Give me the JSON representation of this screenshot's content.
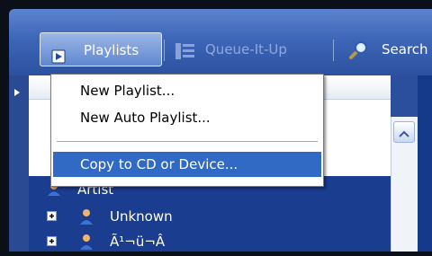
{
  "toolbar": {
    "playlists_label": "Playlists",
    "queue_label": "Queue-It-Up",
    "search_label": "Search"
  },
  "menu": {
    "items": [
      {
        "label": "New Playlist..."
      },
      {
        "label": "New Auto Playlist..."
      },
      {
        "label": "Copy to CD or Device..."
      }
    ]
  },
  "tree": {
    "header": "Artist",
    "rows": [
      {
        "label": "Unknown"
      },
      {
        "label": "Ã¹¬ü¬Â"
      }
    ]
  },
  "icons": {
    "playlists": "playlist-play-icon",
    "queue": "queue-list-icon",
    "search": "magnifier-icon",
    "expand": "plus-expander-icon",
    "artist": "person-icon"
  },
  "colors": {
    "toolbar_blue": "#3e66b8",
    "highlight": "#316ac5",
    "disabled_text": "#91a9d9"
  }
}
